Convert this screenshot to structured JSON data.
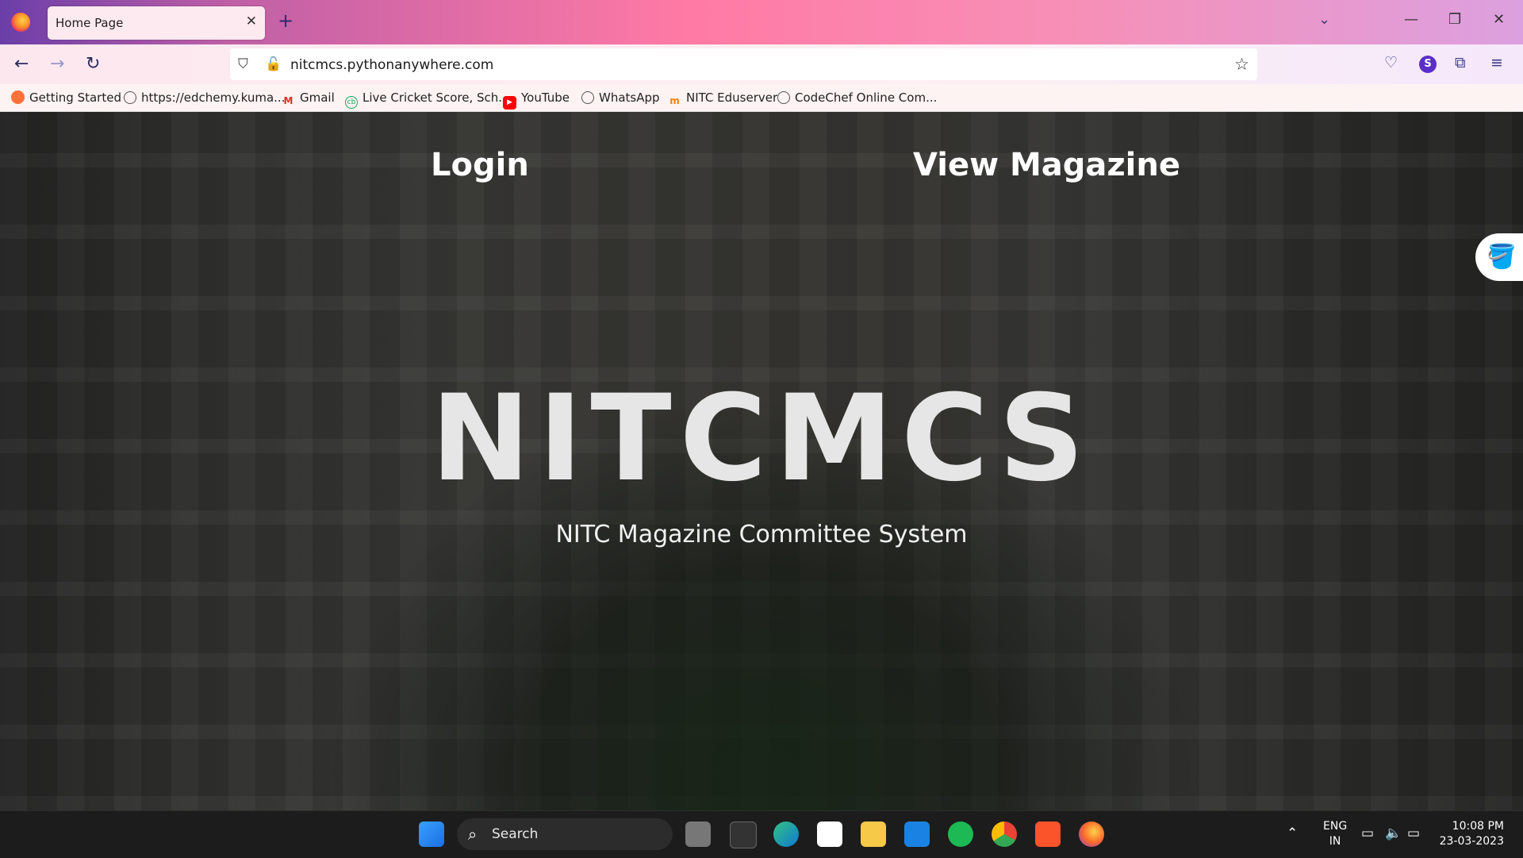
{
  "browser": {
    "tab_title": "Home Page",
    "tab_close": "✕",
    "new_tab": "+",
    "url": "nitcmcs.pythonanywhere.com",
    "avatar_letter": "S",
    "bookmarks": [
      {
        "label": "Getting Started",
        "icon": "firefox-icon"
      },
      {
        "label": "https://edchemy.kuma...",
        "icon": "globe-icon"
      },
      {
        "label": "Gmail",
        "icon": "gmail-icon"
      },
      {
        "label": "Live Cricket Score, Sch...",
        "icon": "cricbuzz-icon"
      },
      {
        "label": "YouTube",
        "icon": "youtube-icon"
      },
      {
        "label": "WhatsApp",
        "icon": "globe-icon"
      },
      {
        "label": "NITC Eduserver",
        "icon": "moodle-icon"
      },
      {
        "label": "CodeChef Online Com...",
        "icon": "globe-icon"
      }
    ]
  },
  "page": {
    "nav": {
      "login": "Login",
      "view_magazine": "View Magazine"
    },
    "hero_title": "NITCMCS",
    "hero_subtitle": "NITC Magazine Committee System"
  },
  "taskbar": {
    "search_label": "Search",
    "lang_top": "ENG",
    "lang_bottom": "IN",
    "time": "10:08 PM",
    "date": "23-03-2023"
  },
  "colors": {
    "accent": "#ff7aa5",
    "avatar": "#5b2ec8",
    "taskbar_bg": "#1c1c1c"
  }
}
